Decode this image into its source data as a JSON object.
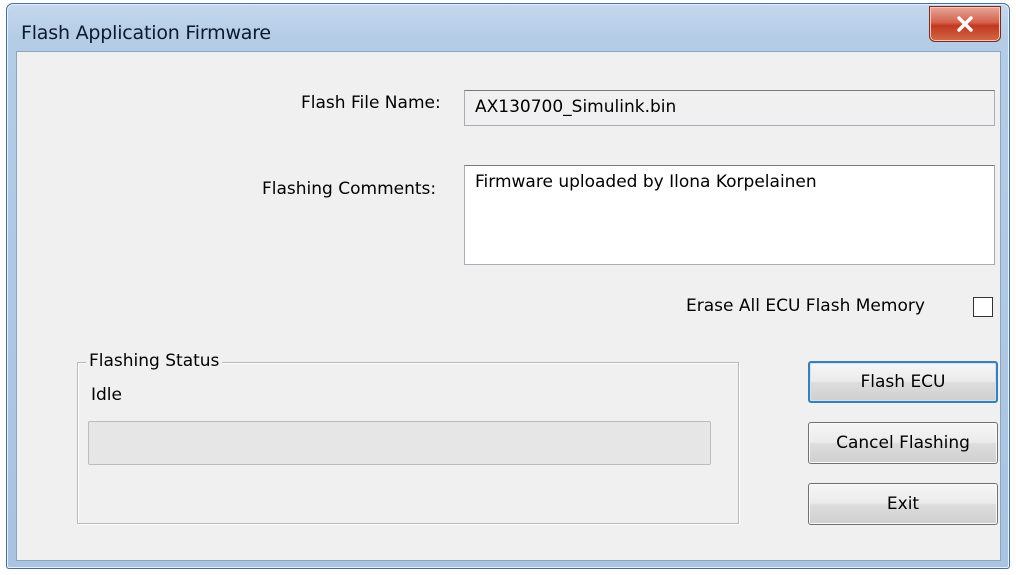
{
  "window": {
    "title": "Flash Application Firmware",
    "close_icon": "close-icon"
  },
  "form": {
    "flash_file_label": "Flash File Name:",
    "flash_file_value": "AX130700_Simulink.bin",
    "comments_label": "Flashing Comments:",
    "comments_value": "Firmware uploaded by Ilona Korpelainen",
    "erase_label": "Erase All ECU Flash Memory",
    "erase_checked": false
  },
  "status": {
    "group_label": "Flashing Status",
    "state_text": "Idle",
    "progress_fraction": 0.0
  },
  "buttons": {
    "flash_label": "Flash ECU",
    "cancel_label": "Cancel Flashing",
    "exit_label": "Exit"
  },
  "colors": {
    "titlebar": "#b5cce6",
    "close_button": "#c2381f",
    "dialog_background": "#f0f0f0",
    "default_button_border": "#3c7fb1",
    "progress_fill": "#06b025"
  }
}
